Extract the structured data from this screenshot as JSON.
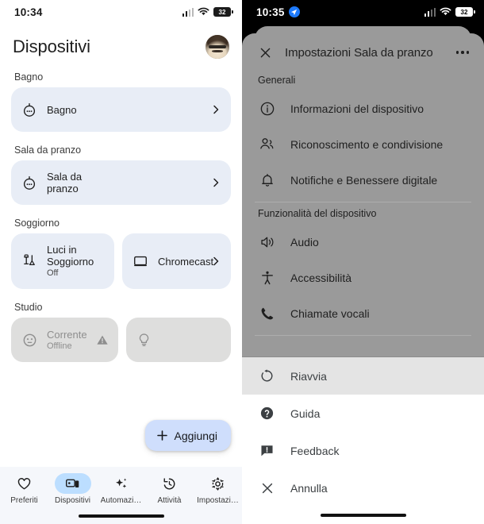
{
  "left": {
    "status": {
      "time": "10:34",
      "battery": "32",
      "signal_icon": "cellular-signal-icon",
      "wifi_icon": "wifi-icon",
      "battery_icon": "battery-icon"
    },
    "title": "Dispositivi",
    "avatar_name": "user-avatar",
    "groups": [
      {
        "label": "Bagno",
        "cards": [
          {
            "name": "Bagno",
            "sub": "",
            "icon": "speaker-dot-icon",
            "chevron": true,
            "offline": false,
            "width": "full"
          }
        ]
      },
      {
        "label": "Sala da pranzo",
        "cards": [
          {
            "name": "Sala da pranzo",
            "sub": "",
            "icon": "speaker-dot-icon",
            "chevron": true,
            "offline": false,
            "width": "full"
          }
        ]
      },
      {
        "label": "Soggiorno",
        "cards": [
          {
            "name": "Luci in Soggiorno",
            "sub": "Off",
            "icon": "lamp-icon",
            "chevron": false,
            "offline": false,
            "width": "half"
          },
          {
            "name": "Chromecast",
            "sub": "",
            "icon": "tv-icon",
            "chevron": true,
            "offline": false,
            "width": "half"
          }
        ]
      },
      {
        "label": "Studio",
        "cards": [
          {
            "name": "Corrente",
            "sub": "Offline",
            "icon": "outlet-icon",
            "chevron": false,
            "warning": true,
            "offline": true,
            "width": "half"
          },
          {
            "name": "",
            "sub": "",
            "icon": "bulb-icon",
            "chevron": false,
            "offline": true,
            "width": "half"
          }
        ]
      }
    ],
    "fab": {
      "label": "Aggiungi",
      "icon": "plus-icon",
      "color": "#cfdefc"
    },
    "nav": [
      {
        "label": "Preferiti",
        "icon": "heart-icon",
        "active": false
      },
      {
        "label": "Dispositivi",
        "icon": "devices-icon",
        "active": true
      },
      {
        "label": "Automazi…",
        "icon": "sparkles-icon",
        "active": false
      },
      {
        "label": "Attività",
        "icon": "history-icon",
        "active": false
      },
      {
        "label": "Impostazi…",
        "icon": "gear-icon",
        "active": false
      }
    ],
    "nav_active_color": "#bcdeff"
  },
  "right": {
    "status": {
      "time": "10:35",
      "battery": "32",
      "location_icon": "location-arrow-icon",
      "signal_icon": "cellular-signal-icon",
      "wifi_icon": "wifi-icon",
      "battery_icon": "battery-icon"
    },
    "sheet": {
      "close_icon": "close-icon",
      "title": "Impostazioni Sala da pranzo",
      "overflow_icon": "more-options-icon",
      "sections": [
        {
          "label": "Generali",
          "rows": [
            {
              "label": "Informazioni del dispositivo",
              "icon": "info-icon"
            },
            {
              "label": "Riconoscimento e condivisione",
              "icon": "people-icon"
            },
            {
              "label": "Notifiche e Benessere digitale",
              "icon": "bell-icon"
            }
          ]
        },
        {
          "label": "Funzionalità del dispositivo",
          "rows": [
            {
              "label": "Audio",
              "icon": "volume-icon"
            },
            {
              "label": "Accessibilità",
              "icon": "accessibility-icon"
            },
            {
              "label": "Chiamate vocali",
              "icon": "phone-icon"
            }
          ]
        }
      ]
    },
    "action_sheet": {
      "rows": [
        {
          "label": "Riavvia",
          "icon": "restart-icon",
          "pressed": true
        },
        {
          "label": "Guida",
          "icon": "help-icon",
          "pressed": false
        },
        {
          "label": "Feedback",
          "icon": "feedback-icon",
          "pressed": false
        },
        {
          "label": "Annulla",
          "icon": "close-icon",
          "pressed": false
        }
      ],
      "pressed_color": "#e4e4e4"
    }
  }
}
